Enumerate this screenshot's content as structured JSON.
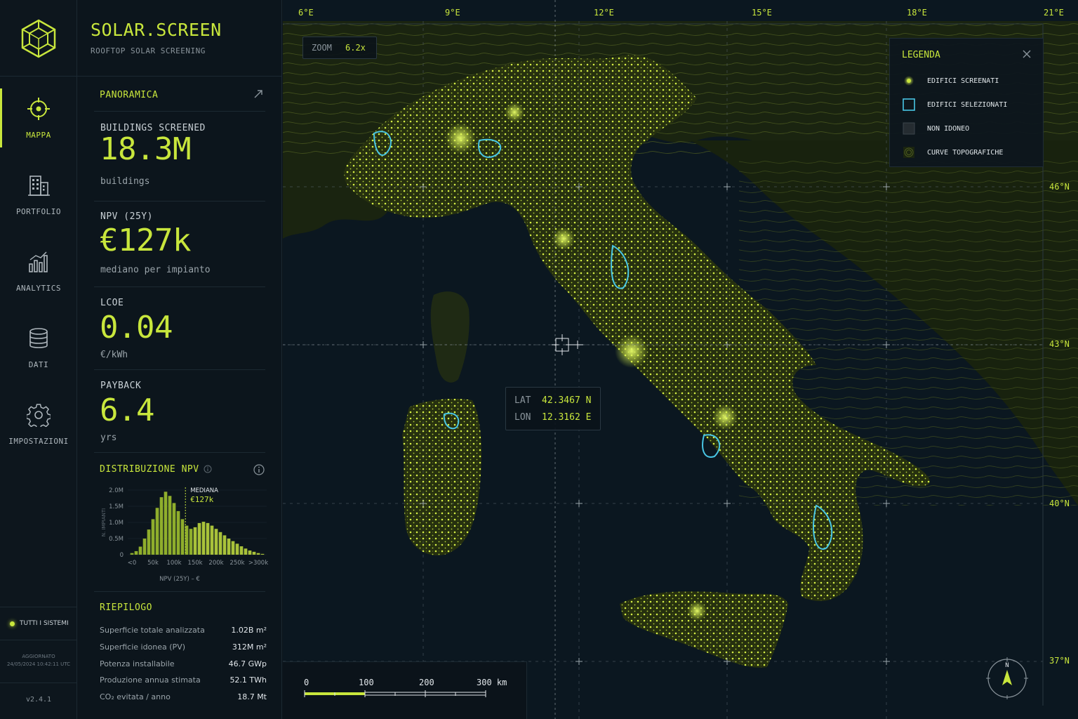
{
  "app": {
    "title": "SOLAR.SCREEN",
    "subtitle": "ROOFTOP SOLAR SCREENING",
    "accent_color": "#c8e63c",
    "background_color": "#0b131a",
    "highlight_color": "#49c6e5"
  },
  "nav": {
    "items": [
      {
        "label": "MAPPA",
        "icon": "crosshair-icon",
        "active": true
      },
      {
        "label": "PORTFOLIO",
        "icon": "building-icon",
        "active": false
      },
      {
        "label": "ANALYTICS",
        "icon": "bar-chart-icon",
        "active": false
      },
      {
        "label": "DATI",
        "icon": "database-icon",
        "active": false
      },
      {
        "label": "IMPOSTAZIONI",
        "icon": "gear-icon",
        "active": false
      }
    ],
    "status": "TUTTI I SISTEMI",
    "updated_label": "AGGIORNATO",
    "updated_value": "24/05/2024 10:42:11 UTC",
    "version": "v2.4.1"
  },
  "overview": {
    "title": "PANORAMICA",
    "stats": [
      {
        "label": "BUILDINGS SCREENED",
        "value": "18.3M",
        "unit": "buildings"
      },
      {
        "label": "NPV (25Y)",
        "value": "€127k",
        "unit": "mediano per impianto"
      },
      {
        "label": "LCOE",
        "value": "0.04",
        "unit": "€/kWh"
      },
      {
        "label": "PAYBACK",
        "value": "6.4",
        "unit": "yrs"
      }
    ]
  },
  "npv_distribution": {
    "title": "DISTRIBUZIONE NPV",
    "median_label": "MEDIANA",
    "median_value": "€127k"
  },
  "chart_data": {
    "type": "bar",
    "xlabel": "NPV (25Y) – €",
    "ylabel": "N. IMPIANTI",
    "ylim": [
      0,
      2000000
    ],
    "y_ticks": [
      "0",
      "0.5M",
      "1.0M",
      "1.5M",
      "2.0M"
    ],
    "x_ticks": [
      "<0",
      "50k",
      "100k",
      "150k",
      "200k",
      "250k",
      ">300k"
    ],
    "x_range": [
      -10,
      320
    ],
    "bin_centers": [
      0,
      10,
      20,
      30,
      40,
      50,
      60,
      70,
      80,
      90,
      100,
      110,
      120,
      130,
      140,
      150,
      160,
      170,
      180,
      190,
      200,
      210,
      220,
      230,
      240,
      250,
      260,
      270,
      280,
      290,
      300,
      310
    ],
    "values": [
      50000,
      110000,
      250000,
      500000,
      780000,
      1100000,
      1450000,
      1780000,
      1950000,
      1820000,
      1600000,
      1350000,
      1100000,
      900000,
      800000,
      850000,
      980000,
      1020000,
      980000,
      900000,
      800000,
      700000,
      600000,
      500000,
      420000,
      340000,
      260000,
      190000,
      130000,
      90000,
      50000,
      25000
    ],
    "median_x": 127,
    "median_label": "MEDIANA",
    "median_value": "€127k"
  },
  "summary": {
    "title": "RIEPILOGO",
    "rows": [
      {
        "label": "Superficie totale analizzata",
        "value": "1.02B m²"
      },
      {
        "label": "Superficie idonea (PV)",
        "value": "312M m²"
      },
      {
        "label": "Potenza installabile",
        "value": "46.7 GWp"
      },
      {
        "label": "Produzione annua stimata",
        "value": "52.1 TWh"
      },
      {
        "label": "CO₂ evitata / anno",
        "value": "18.7 Mt"
      }
    ]
  },
  "map": {
    "zoom_label": "ZOOM",
    "zoom_value": "6.2x",
    "longitudes": [
      "6°E",
      "9°E",
      "12°E",
      "15°E",
      "18°E",
      "21°E"
    ],
    "latitudes": [
      "46°N",
      "43°N",
      "40°N",
      "37°N"
    ],
    "cursor": {
      "lat_label": "LAT",
      "lat_value": "42.3467 N",
      "lon_label": "LON",
      "lon_value": "12.3162 E"
    },
    "legend": {
      "title": "LEGENDA",
      "items": [
        {
          "label": "EDIFICI SCREENATI",
          "swatch": "dot"
        },
        {
          "label": "EDIFICI SELEZIONATI",
          "swatch": "outline"
        },
        {
          "label": "NON IDONEO",
          "swatch": "dark-square"
        },
        {
          "label": "CURVE TOPOGRAFICHE",
          "swatch": "contour"
        }
      ]
    },
    "scale": {
      "labels": [
        "0",
        "100",
        "200",
        "300 km"
      ]
    },
    "compass_label": "N"
  }
}
